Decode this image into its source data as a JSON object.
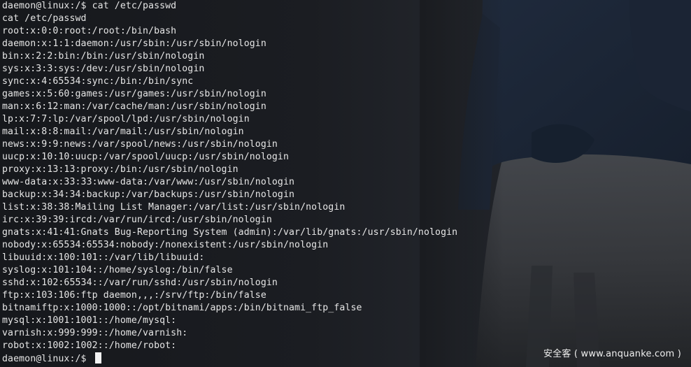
{
  "terminal": {
    "lines": [
      "daemon@linux:/$ cat /etc/passwd",
      "cat /etc/passwd",
      "root:x:0:0:root:/root:/bin/bash",
      "daemon:x:1:1:daemon:/usr/sbin:/usr/sbin/nologin",
      "bin:x:2:2:bin:/bin:/usr/sbin/nologin",
      "sys:x:3:3:sys:/dev:/usr/sbin/nologin",
      "sync:x:4:65534:sync:/bin:/bin/sync",
      "games:x:5:60:games:/usr/games:/usr/sbin/nologin",
      "man:x:6:12:man:/var/cache/man:/usr/sbin/nologin",
      "lp:x:7:7:lp:/var/spool/lpd:/usr/sbin/nologin",
      "mail:x:8:8:mail:/var/mail:/usr/sbin/nologin",
      "news:x:9:9:news:/var/spool/news:/usr/sbin/nologin",
      "uucp:x:10:10:uucp:/var/spool/uucp:/usr/sbin/nologin",
      "proxy:x:13:13:proxy:/bin:/usr/sbin/nologin",
      "www-data:x:33:33:www-data:/var/www:/usr/sbin/nologin",
      "backup:x:34:34:backup:/var/backups:/usr/sbin/nologin",
      "list:x:38:38:Mailing List Manager:/var/list:/usr/sbin/nologin",
      "irc:x:39:39:ircd:/var/run/ircd:/usr/sbin/nologin",
      "gnats:x:41:41:Gnats Bug-Reporting System (admin):/var/lib/gnats:/usr/sbin/nologin",
      "nobody:x:65534:65534:nobody:/nonexistent:/usr/sbin/nologin",
      "libuuid:x:100:101::/var/lib/libuuid:",
      "syslog:x:101:104::/home/syslog:/bin/false",
      "sshd:x:102:65534::/var/run/sshd:/usr/sbin/nologin",
      "ftp:x:103:106:ftp daemon,,,:/srv/ftp:/bin/false",
      "bitnamiftp:x:1000:1000::/opt/bitnami/apps:/bin/bitnami_ftp_false",
      "mysql:x:1001:1001::/home/mysql:",
      "varnish:x:999:999::/home/varnish:",
      "robot:x:1002:1002::/home/robot:"
    ],
    "prompt": "daemon@linux:/$ "
  },
  "watermark": {
    "text": "安全客 ( www.anquanke.com )"
  },
  "colors": {
    "text": "#e6e6e6",
    "background": "#1a1c20"
  },
  "icons": {
    "cursor": "block-cursor"
  }
}
